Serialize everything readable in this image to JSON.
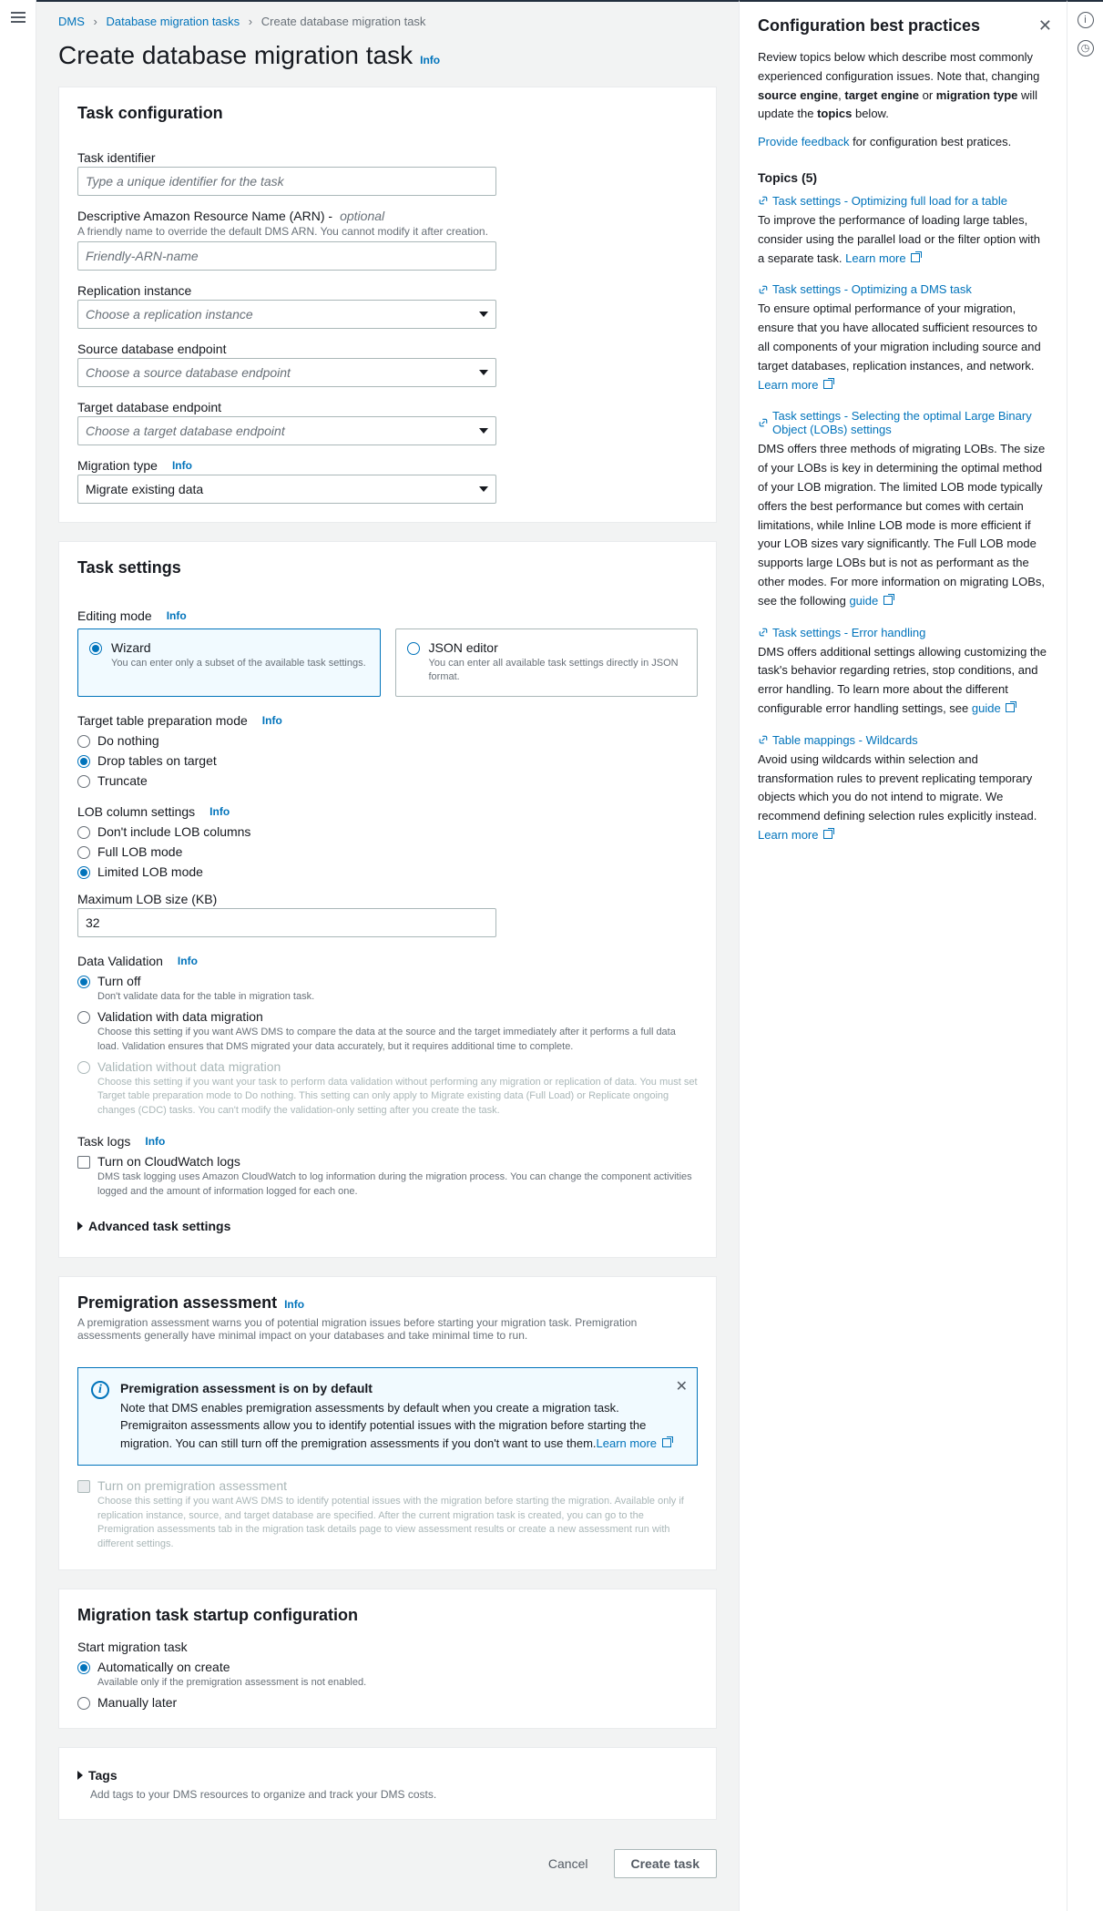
{
  "breadcrumb": {
    "a": "DMS",
    "b": "Database migration tasks",
    "c": "Create database migration task"
  },
  "page": {
    "title": "Create database migration task",
    "info": "Info"
  },
  "taskConfig": {
    "heading": "Task configuration",
    "identLabel": "Task identifier",
    "identPh": "Type a unique identifier for the task",
    "arnLabel": "Descriptive Amazon Resource Name (ARN) - ",
    "arnOpt": "optional",
    "arnDesc": "A friendly name to override the default DMS ARN. You cannot modify it after creation.",
    "arnPh": "Friendly-ARN-name",
    "repLabel": "Replication instance",
    "repPh": "Choose a replication instance",
    "srcLabel": "Source database endpoint",
    "srcPh": "Choose a source database endpoint",
    "tgtLabel": "Target database endpoint",
    "tgtPh": "Choose a target database endpoint",
    "migLabel": "Migration type",
    "migVal": "Migrate existing data"
  },
  "taskSettings": {
    "heading": "Task settings",
    "editMode": "Editing mode",
    "wizard": {
      "t": "Wizard",
      "d": "You can enter only a subset of the available task settings."
    },
    "json": {
      "t": "JSON editor",
      "d": "You can enter all available task settings directly in JSON format."
    },
    "prepMode": "Target table preparation mode",
    "prep1": "Do nothing",
    "prep2": "Drop tables on target",
    "prep3": "Truncate",
    "lobHead": "LOB column settings",
    "lob1": "Don't include LOB columns",
    "lob2": "Full LOB mode",
    "lob3": "Limited LOB mode",
    "maxLob": "Maximum LOB size (KB)",
    "maxLobVal": "32",
    "dvHead": "Data Validation",
    "dv1": {
      "t": "Turn off",
      "d": "Don't validate data for the table in migration task."
    },
    "dv2": {
      "t": "Validation with data migration",
      "d": "Choose this setting if you want AWS DMS to compare the data at the source and the target immediately after it performs a full data load. Validation ensures that DMS migrated your data accurately, but it requires additional time to complete."
    },
    "dv3": {
      "t": "Validation without data migration",
      "d": "Choose this setting if you want your task to perform data validation without performing any migration or replication of data. You must set Target table preparation mode to Do nothing. This setting can only apply to Migrate existing data (Full Load) or Replicate ongoing changes (CDC) tasks. You can't modify the validation-only setting after you create the task."
    },
    "logsHead": "Task logs",
    "logs": {
      "t": "Turn on CloudWatch logs",
      "d": "DMS task logging uses Amazon CloudWatch to log information during the migration process. You can change the component activities logged and the amount of information logged for each one."
    },
    "adv": "Advanced task settings"
  },
  "premig": {
    "heading": "Premigration assessment",
    "sub": "A premigration assessment warns you of potential migration issues before starting your migration task. Premigration assessments generally have minimal impact on your databases and take minimal time to run.",
    "alertTitle": "Premigration assessment is on by default",
    "alertBody": "Note that DMS enables premigration assessments by default when you create a migration task. Premigraiton assessments allow you to identify potential issues with the migration before starting the migration. You can still turn off the premigration assessments if you don't want to use them.",
    "learn": "Learn more",
    "chk": {
      "t": "Turn on premigration assessment",
      "d": "Choose this setting if you want AWS DMS to identify potential issues with the migration before starting the migration. Available only if replication instance, source, and target database are specified. After the current migration task is created, you can go to the Premigration assessments tab in the migration task details page to view assessment results or create a new assessment run with different settings."
    }
  },
  "startup": {
    "heading": "Migration task startup configuration",
    "label": "Start migration task",
    "r1": {
      "t": "Automatically on create",
      "d": "Available only if the premigration assessment is not enabled."
    },
    "r2": "Manually later"
  },
  "tags": {
    "heading": "Tags",
    "sub": "Add tags to your DMS resources to organize and track your DMS costs."
  },
  "footer": {
    "cancel": "Cancel",
    "create": "Create task"
  },
  "help": {
    "title": "Configuration best practices",
    "intro1": "Review topics below which describe most commonly experienced configuration issues. Note that, changing ",
    "intro_b1": "source engine",
    "intro_c": ", ",
    "intro_b2": "target engine",
    "intro_d": " or ",
    "intro_b3": "migration type",
    "intro_e": " will update the ",
    "intro_b4": "topics",
    "intro_f": " below.",
    "feedback": "Provide feedback",
    "feedback2": " for configuration best pratices.",
    "topicsHead": "Topics (5)",
    "topics": [
      {
        "t": "Task settings - Optimizing full load for a table",
        "b": "To improve the performance of loading large tables, consider using the parallel load or the filter option with a separate task. ",
        "lm": "Learn more"
      },
      {
        "t": "Task settings - Optimizing a DMS task",
        "b": "To ensure optimal performance of your migration, ensure that you have allocated sufficient resources to all components of your migration including source and target databases, replication instances, and network. ",
        "lm": "Learn more"
      },
      {
        "t": "Task settings - Selecting the optimal Large Binary Object (LOBs) settings",
        "b": "DMS offers three methods of migrating LOBs. The size of your LOBs is key in determining the optimal method of your LOB migration. The limited LOB mode typically offers the best performance but comes with certain limitations, while Inline LOB mode is more efficient if your LOB sizes vary significantly. The Full LOB mode supports large LOBs but is not as performant as the other modes. For more information on migrating LOBs, see the following ",
        "lm": "guide"
      },
      {
        "t": "Task settings - Error handling",
        "b": "DMS offers additional settings allowing customizing the task's behavior regarding retries, stop conditions, and error handling. To learn more about the different configurable error handling settings, see ",
        "lm": "guide"
      },
      {
        "t": "Table mappings - Wildcards",
        "b": "Avoid using wildcards within selection and transformation rules to prevent replicating temporary objects which you do not intend to migrate. We recommend defining selection rules explicitly instead. ",
        "lm": "Learn more"
      }
    ]
  }
}
